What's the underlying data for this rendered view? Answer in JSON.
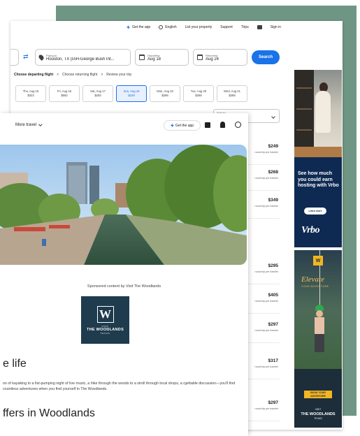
{
  "topnav": {
    "get_app": "Get the app",
    "language": "English",
    "list_property": "List your property",
    "support": "Support",
    "trips": "Trips",
    "sign_in": "Sign in"
  },
  "search": {
    "from_label": "Flying to",
    "from_value": "Houston, TX (IAH-George Bush Int...",
    "departing_label": "Departing",
    "departing_value": "Aug 18",
    "returning_label": "Returning",
    "returning_value": "Aug 24",
    "button": "Search"
  },
  "breadcrumb": {
    "step1": "Choose departing flight",
    "step2": "Choose returning flight",
    "step3": "Review your trip",
    "separator": ">"
  },
  "date_options": [
    {
      "day": "Thu, Aug 15",
      "price": "$323"
    },
    {
      "day": "Fri, Aug 16",
      "price": "$562"
    },
    {
      "day": "Sat, Aug 17",
      "price": "$293"
    },
    {
      "day": "Sun, Aug 18",
      "price": "$249"
    },
    {
      "day": "Mon, Aug 19",
      "price": "$268"
    },
    {
      "day": "Tue, Aug 20",
      "price": "$268"
    },
    {
      "day": "Wed, Aug 21",
      "price": "$268"
    }
  ],
  "sort": {
    "label": "Sort by"
  },
  "prices": [
    {
      "amount": "$249",
      "note": "round trip per traveler"
    },
    {
      "amount": "$268",
      "note": "round trip per traveler"
    },
    {
      "amount": "$349",
      "note": "round trip per traveler"
    },
    {
      "amount": "$295",
      "note": "round trip per traveler"
    },
    {
      "amount": "$405",
      "note": "round trip per traveler"
    },
    {
      "amount": "$297",
      "note": "round trip per traveler"
    },
    {
      "amount": "$317",
      "note": "round trip per traveler"
    },
    {
      "amount": "$297",
      "note": "round trip per traveler"
    }
  ],
  "ad_vrbo": {
    "headline": "See how much you could earn hosting with Vrbo",
    "button": "Learn more",
    "brand": "Vrbo"
  },
  "ad_woodlands": {
    "logo_letter": "W",
    "title": "Elevate",
    "subtitle": "YOUR ADVENTURE",
    "button": "BOOK YOUR ADVENTURE",
    "brand_small": "VISIT",
    "brand": "THE WOODLANDS",
    "brand_tail": "TEXAS"
  },
  "front": {
    "more_travel": "More travel",
    "get_app": "Get the app",
    "sponsored": "Sponsored content by Visit The Woodlands",
    "logo_letter": "W",
    "logo_small": "VISIT",
    "logo_name": "THE WOODLANDS",
    "logo_tail": "TEXAS",
    "heading1": "e life",
    "paragraph": "on of kayaking to a fist-pumping night of live music, a hike through the woods to a stroll through local shops, a rgettable discussion—you'll find countless adventures when you find yourself in The Woodlands.",
    "heading2": "ffers in Woodlands"
  },
  "colors": {
    "accent": "#1a73e8",
    "green_backdrop": "#6f9684",
    "vrbo_navy": "#0e2a52",
    "woodlands_navy": "#1f3b4e",
    "woodlands_gold": "#f2b523"
  }
}
